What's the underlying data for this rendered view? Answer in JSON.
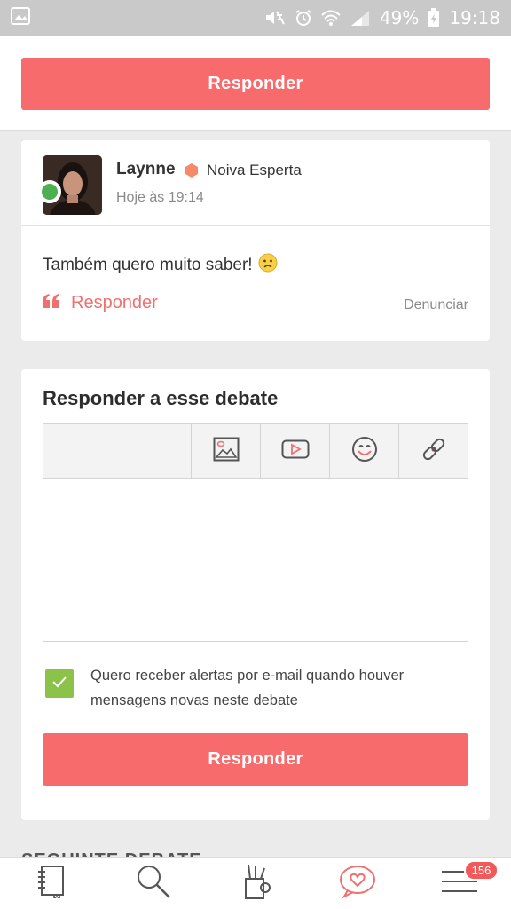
{
  "status_bar": {
    "battery": "49%",
    "time": "19:18",
    "icons": [
      "gallery-icon",
      "mute-icon",
      "alarm-icon",
      "wifi-icon",
      "signal-icon",
      "battery-charging-icon"
    ]
  },
  "top": {
    "reply_label": "Responder"
  },
  "post": {
    "author": "Laynne",
    "badge": "Noiva Esperta",
    "time": "Hoje às 19:14",
    "body": "Também quero muito saber!",
    "emoji": "🙁",
    "reply_label": "Responder",
    "report_label": "Denunciar"
  },
  "reply_form": {
    "title": "Responder a esse debate",
    "toolbar": [
      "image-icon",
      "video-icon",
      "emoji-icon",
      "link-icon"
    ],
    "editor_value": "",
    "checkbox_checked": true,
    "checkbox_label": "Quero receber alertas por e-mail quando houver mensagens novas neste debate",
    "submit_label": "Responder"
  },
  "follow_heading": "SEGUINTE DEBATE",
  "bottom_nav": {
    "items": [
      "notebook-icon",
      "search-icon",
      "tools-icon",
      "community-heart-icon",
      "menu-icon"
    ],
    "badge_count": "156"
  },
  "colors": {
    "accent": "#f76b6c",
    "checkbox": "#8bc34a",
    "online": "#4caf50",
    "badge": "#f5896a"
  }
}
